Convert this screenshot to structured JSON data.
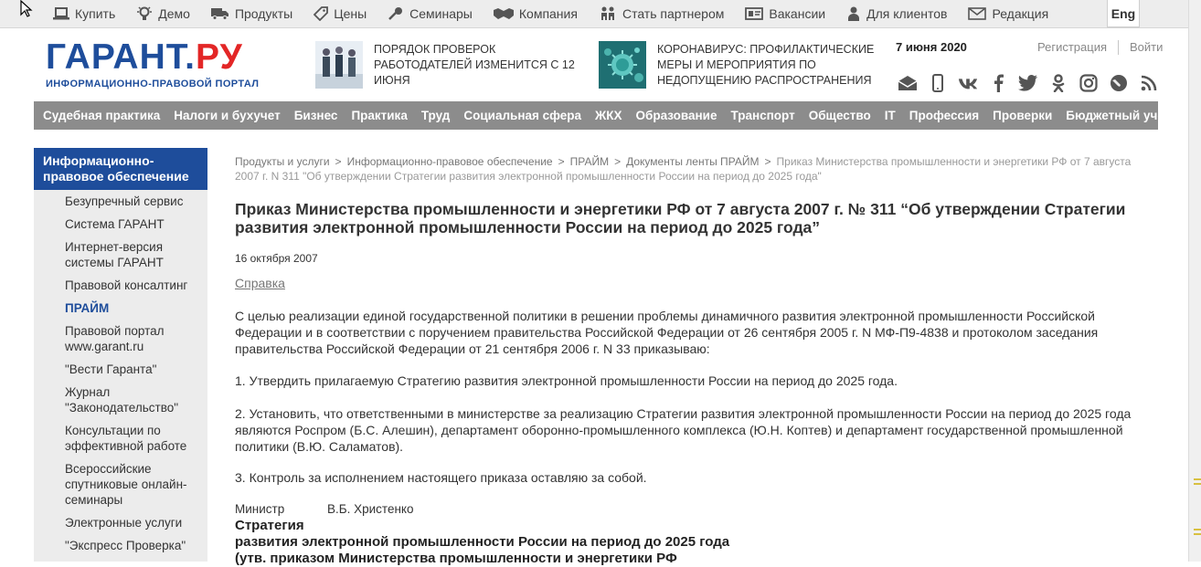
{
  "topnav": [
    {
      "icon": "laptop-icon",
      "label": "Купить"
    },
    {
      "icon": "bulb-icon",
      "label": "Демо"
    },
    {
      "icon": "truck-icon",
      "label": "Продукты"
    },
    {
      "icon": "tag-icon",
      "label": "Цены"
    },
    {
      "icon": "microphone-icon",
      "label": "Семинары"
    },
    {
      "icon": "handshake-icon",
      "label": "Компания"
    },
    {
      "icon": "people-icon",
      "label": "Стать партнером"
    },
    {
      "icon": "id-card-icon",
      "label": "Вакансии"
    },
    {
      "icon": "person-icon",
      "label": "Для клиентов"
    },
    {
      "icon": "envelope-icon",
      "label": "Редакция"
    }
  ],
  "lang": "Eng",
  "logo": {
    "part1": "ГАРАНТ",
    "dot": ".",
    "part2": "РУ",
    "subtitle": "ИНФОРМАЦИОННО-ПРАВОВОЙ ПОРТАЛ"
  },
  "promos": [
    {
      "text": "Порядок проверок работодателей изменится с 12 июня"
    },
    {
      "text": "Коронавирус: профилактические меры и мероприятия по недопущению распространения"
    }
  ],
  "header": {
    "date": "7 июня 2020",
    "register": "Регистрация",
    "login": "Войти"
  },
  "social": [
    "mail-icon",
    "mobile-icon",
    "vk-icon",
    "facebook-icon",
    "twitter-icon",
    "odnoklassniki-icon",
    "instagram-icon",
    "livejournal-icon",
    "rss-icon"
  ],
  "mainnav": [
    "Судебная практика",
    "Налоги и бухучет",
    "Бизнес",
    "Практика",
    "Труд",
    "Социальная сфера",
    "ЖКХ",
    "Образование",
    "Транспорт",
    "Общество",
    "IT",
    "Профессия",
    "Проверки",
    "Бюджетный учет"
  ],
  "sidebar": {
    "title": "Информационно-правовое обеспечение",
    "items": [
      "Безупречный сервис",
      "Система ГАРАНТ",
      "Интернет-версия системы ГАРАНТ",
      "Правовой консалтинг",
      "ПРАЙМ",
      "Правовой портал www.garant.ru",
      "\"Вести Гаранта\"",
      "Журнал \"Законодательство\"",
      "Консультации по эффективной работе",
      "Всероссийские спутниковые онлайн-семинары",
      "Электронные услуги",
      "\"Экспресс Проверка\""
    ]
  },
  "breadcrumbs": [
    "Продукты и услуги",
    "Информационно-правовое обеспечение",
    "ПРАЙМ",
    "Документы ленты ПРАЙМ",
    "Приказ Министерства промышленности и энергетики РФ от 7 августа 2007 г. N 311 \"Об утверждении Стратегии развития электронной промышленности России на период до 2025 года\""
  ],
  "breadcrumb_sep": ">",
  "document": {
    "title": "Приказ Министерства промышленности и энергетики РФ от 7 августа 2007 г. № 311 “Об утверждении Стратегии развития электронной промышленности России на период до 2025 года”",
    "date": "16 октября 2007",
    "reference_link": "Справка",
    "paragraphs": [
      "С целью реализации единой государственной политики в решении проблемы динамичного развития электронной промышленности Российской Федерации и в соответствии с поручением правительства Российской Федерации от 26 сентября 2005 г. N МФ-П9-4838 и протоколом заседания правительства Российской Федерации от 21 сентября 2006 г. N 33 приказываю:",
      "1. Утвердить прилагаемую Стратегию развития электронной промышленности России на период до 2025 года.",
      "2. Установить, что ответственными в министерстве за реализацию Стратегии развития электронной промышленности России на период до 2025 года являются Роспром (Б.С. Алешин), департамент оборонно-промышленного комплекса (Ю.Н. Коптев) и департамент государственной промышленной политики (В.Ю. Саламатов).",
      "3. Контроль за исполнением настоящего приказа оставляю за собой."
    ],
    "signer_role": "Министр",
    "signer_name": "В.Б. Христенко",
    "strategy_lines": [
      "Стратегия",
      "развития электронной промышленности России на период до 2025 года",
      "(утв. приказом Министерства промышленности и энергетики РФ"
    ]
  }
}
